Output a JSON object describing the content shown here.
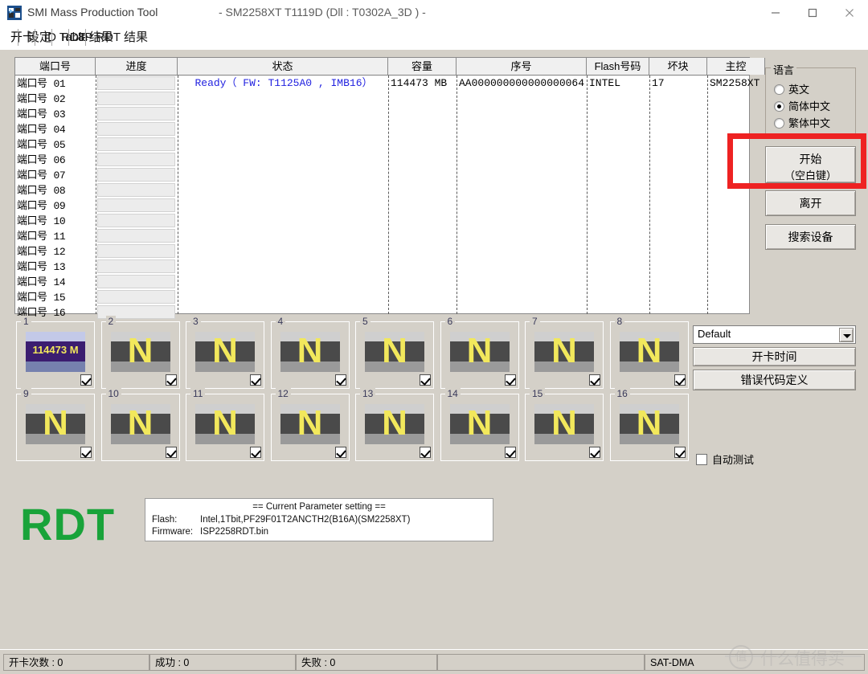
{
  "window": {
    "title": "SMI Mass Production Tool",
    "subtitle": "- SM2258XT   T1119D    (Dll : T0302A_3D ) -",
    "minimize_label": "minimize",
    "maximize_label": "maximize",
    "close_label": "close"
  },
  "tabs": [
    {
      "label": "开卡",
      "selected": true
    },
    {
      "label": "设定",
      "selected": false
    },
    {
      "label": "ID Table",
      "selected": false
    },
    {
      "label": "RDT 结果",
      "selected": false
    },
    {
      "label": "8P RDT 结果",
      "selected": false
    }
  ],
  "grid": {
    "columns": [
      {
        "key": "port",
        "label": "端口号"
      },
      {
        "key": "progress",
        "label": "进度"
      },
      {
        "key": "status",
        "label": "状态"
      },
      {
        "key": "capacity",
        "label": "容量"
      },
      {
        "key": "serial",
        "label": "序号"
      },
      {
        "key": "flash",
        "label": "Flash号码"
      },
      {
        "key": "badblock",
        "label": "坏块"
      },
      {
        "key": "ctrl",
        "label": "主控"
      }
    ],
    "port_prefix": "端口号",
    "rows": [
      {
        "port": "01",
        "progress": "",
        "status": "Ready（ FW: T1125A0 ,   IMB16）",
        "capacity": "114473 MB",
        "serial": "AA000000000000000064",
        "flash": "INTEL",
        "badblock": "17",
        "ctrl": "SM2258XT"
      },
      {
        "port": "02",
        "progress": "",
        "status": "",
        "capacity": "",
        "serial": "",
        "flash": "",
        "badblock": "",
        "ctrl": ""
      },
      {
        "port": "03",
        "progress": "",
        "status": "",
        "capacity": "",
        "serial": "",
        "flash": "",
        "badblock": "",
        "ctrl": ""
      },
      {
        "port": "04",
        "progress": "",
        "status": "",
        "capacity": "",
        "serial": "",
        "flash": "",
        "badblock": "",
        "ctrl": ""
      },
      {
        "port": "05",
        "progress": "",
        "status": "",
        "capacity": "",
        "serial": "",
        "flash": "",
        "badblock": "",
        "ctrl": ""
      },
      {
        "port": "06",
        "progress": "",
        "status": "",
        "capacity": "",
        "serial": "",
        "flash": "",
        "badblock": "",
        "ctrl": ""
      },
      {
        "port": "07",
        "progress": "",
        "status": "",
        "capacity": "",
        "serial": "",
        "flash": "",
        "badblock": "",
        "ctrl": ""
      },
      {
        "port": "08",
        "progress": "",
        "status": "",
        "capacity": "",
        "serial": "",
        "flash": "",
        "badblock": "",
        "ctrl": ""
      },
      {
        "port": "09",
        "progress": "",
        "status": "",
        "capacity": "",
        "serial": "",
        "flash": "",
        "badblock": "",
        "ctrl": ""
      },
      {
        "port": "10",
        "progress": "",
        "status": "",
        "capacity": "",
        "serial": "",
        "flash": "",
        "badblock": "",
        "ctrl": ""
      },
      {
        "port": "11",
        "progress": "",
        "status": "",
        "capacity": "",
        "serial": "",
        "flash": "",
        "badblock": "",
        "ctrl": ""
      },
      {
        "port": "12",
        "progress": "",
        "status": "",
        "capacity": "",
        "serial": "",
        "flash": "",
        "badblock": "",
        "ctrl": ""
      },
      {
        "port": "13",
        "progress": "",
        "status": "",
        "capacity": "",
        "serial": "",
        "flash": "",
        "badblock": "",
        "ctrl": ""
      },
      {
        "port": "14",
        "progress": "",
        "status": "",
        "capacity": "",
        "serial": "",
        "flash": "",
        "badblock": "",
        "ctrl": ""
      },
      {
        "port": "15",
        "progress": "",
        "status": "",
        "capacity": "",
        "serial": "",
        "flash": "",
        "badblock": "",
        "ctrl": ""
      },
      {
        "port": "16",
        "progress": "",
        "status": "",
        "capacity": "",
        "serial": "",
        "flash": "",
        "badblock": "",
        "ctrl": ""
      }
    ]
  },
  "language": {
    "group_label": "语言",
    "options": [
      {
        "label": "英文",
        "selected": false
      },
      {
        "label": "简体中文",
        "selected": true
      },
      {
        "label": "繁体中文",
        "selected": false
      }
    ]
  },
  "actions": {
    "start_line1": "开始",
    "start_line2": "（空白键）",
    "exit": "离开",
    "search_device": "搜索设备",
    "time_button": "开卡时间",
    "errorcode_button": "错误代码定义"
  },
  "profile_combo": {
    "value": "Default",
    "options": [
      "Default"
    ]
  },
  "auto_test": {
    "label": "自动测试",
    "checked": false
  },
  "tiles": {
    "n_glyph": "N",
    "first_tile_text": "114473 M",
    "items": [
      {
        "num": "1",
        "checked": true,
        "first": true
      },
      {
        "num": "2",
        "checked": true,
        "first": false
      },
      {
        "num": "3",
        "checked": true,
        "first": false
      },
      {
        "num": "4",
        "checked": true,
        "first": false
      },
      {
        "num": "5",
        "checked": true,
        "first": false
      },
      {
        "num": "6",
        "checked": true,
        "first": false
      },
      {
        "num": "7",
        "checked": true,
        "first": false
      },
      {
        "num": "8",
        "checked": true,
        "first": false
      },
      {
        "num": "9",
        "checked": true,
        "first": false
      },
      {
        "num": "10",
        "checked": true,
        "first": false
      },
      {
        "num": "11",
        "checked": true,
        "first": false
      },
      {
        "num": "12",
        "checked": true,
        "first": false
      },
      {
        "num": "13",
        "checked": true,
        "first": false
      },
      {
        "num": "14",
        "checked": true,
        "first": false
      },
      {
        "num": "15",
        "checked": true,
        "first": false
      },
      {
        "num": "16",
        "checked": true,
        "first": false
      }
    ]
  },
  "logo": {
    "text": "RDT",
    "color": "#19a33a"
  },
  "parameters": {
    "heading": "== Current Parameter setting ==",
    "flash_label": "Flash:",
    "flash_value": "Intel,1Tbit,PF29F01T2ANCTH2(B16A)(SM2258XT)",
    "firmware_label": "Firmware:",
    "firmware_value": "ISP2258RDT.bin"
  },
  "statusbar": {
    "cells": [
      "开卡次数 : 0",
      "成功 : 0",
      "失败 : 0",
      "",
      "SAT-DMA"
    ]
  },
  "annotation": {
    "color": "#ee2222"
  },
  "watermark": {
    "mark": "值",
    "text": "什么值得买"
  }
}
